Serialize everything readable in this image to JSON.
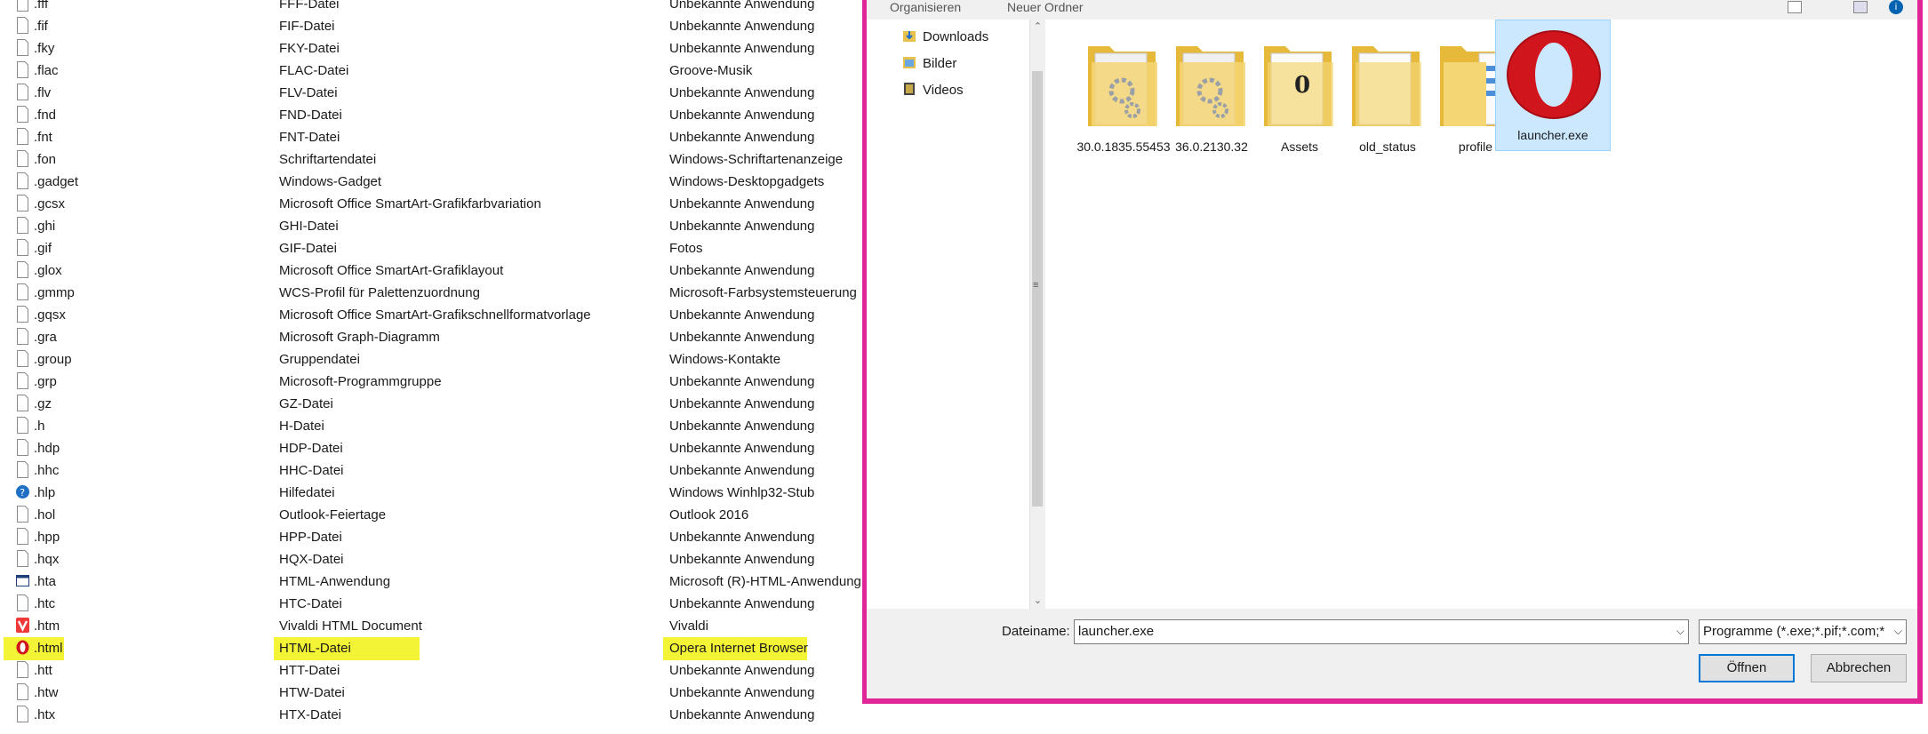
{
  "list": {
    "rows": [
      {
        "ext": ".fff",
        "desc": "FFF-Datei",
        "app": "Unbekannte Anwendung"
      },
      {
        "ext": ".fif",
        "desc": "FIF-Datei",
        "app": "Unbekannte Anwendung"
      },
      {
        "ext": ".fky",
        "desc": "FKY-Datei",
        "app": "Unbekannte Anwendung"
      },
      {
        "ext": ".flac",
        "desc": "FLAC-Datei",
        "app": "Groove-Musik"
      },
      {
        "ext": ".flv",
        "desc": "FLV-Datei",
        "app": "Unbekannte Anwendung"
      },
      {
        "ext": ".fnd",
        "desc": "FND-Datei",
        "app": "Unbekannte Anwendung"
      },
      {
        "ext": ".fnt",
        "desc": "FNT-Datei",
        "app": "Unbekannte Anwendung"
      },
      {
        "ext": ".fon",
        "desc": "Schriftartendatei",
        "app": "Windows-Schriftartenanzeige"
      },
      {
        "ext": ".gadget",
        "desc": "Windows-Gadget",
        "app": "Windows-Desktopgadgets"
      },
      {
        "ext": ".gcsx",
        "desc": "Microsoft Office SmartArt-Grafikfarbvariation",
        "app": "Unbekannte Anwendung"
      },
      {
        "ext": ".ghi",
        "desc": "GHI-Datei",
        "app": "Unbekannte Anwendung"
      },
      {
        "ext": ".gif",
        "desc": "GIF-Datei",
        "app": "Fotos"
      },
      {
        "ext": ".glox",
        "desc": "Microsoft Office SmartArt-Grafiklayout",
        "app": "Unbekannte Anwendung"
      },
      {
        "ext": ".gmmp",
        "desc": "WCS-Profil für Palettenzuordnung",
        "app": "Microsoft-Farbsystemsteuerung"
      },
      {
        "ext": ".gqsx",
        "desc": "Microsoft Office SmartArt-Grafikschnellformatvorlage",
        "app": "Unbekannte Anwendung"
      },
      {
        "ext": ".gra",
        "desc": "Microsoft Graph-Diagramm",
        "app": "Unbekannte Anwendung"
      },
      {
        "ext": ".group",
        "desc": "Gruppendatei",
        "app": "Windows-Kontakte"
      },
      {
        "ext": ".grp",
        "desc": "Microsoft-Programmgruppe",
        "app": "Unbekannte Anwendung"
      },
      {
        "ext": ".gz",
        "desc": "GZ-Datei",
        "app": "Unbekannte Anwendung"
      },
      {
        "ext": ".h",
        "desc": "H-Datei",
        "app": "Unbekannte Anwendung"
      },
      {
        "ext": ".hdp",
        "desc": "HDP-Datei",
        "app": "Unbekannte Anwendung"
      },
      {
        "ext": ".hhc",
        "desc": "HHC-Datei",
        "app": "Unbekannte Anwendung"
      },
      {
        "ext": ".hlp",
        "desc": "Hilfedatei",
        "app": "Windows Winhlp32-Stub"
      },
      {
        "ext": ".hol",
        "desc": "Outlook-Feiertage",
        "app": "Outlook 2016"
      },
      {
        "ext": ".hpp",
        "desc": "HPP-Datei",
        "app": "Unbekannte Anwendung"
      },
      {
        "ext": ".hqx",
        "desc": "HQX-Datei",
        "app": "Unbekannte Anwendung"
      },
      {
        "ext": ".hta",
        "desc": "HTML-Anwendung",
        "app": "Microsoft (R)-HTML-Anwendung"
      },
      {
        "ext": ".htc",
        "desc": "HTC-Datei",
        "app": "Unbekannte Anwendung"
      },
      {
        "ext": ".htm",
        "desc": "Vivaldi HTML Document",
        "app": "Vivaldi"
      },
      {
        "ext": ".html",
        "desc": "HTML-Datei",
        "app": "Opera Internet Browser"
      },
      {
        "ext": ".htt",
        "desc": "HTT-Datei",
        "app": "Unbekannte Anwendung"
      },
      {
        "ext": ".htw",
        "desc": "HTW-Datei",
        "app": "Unbekannte Anwendung"
      },
      {
        "ext": ".htx",
        "desc": "HTX-Datei",
        "app": "Unbekannte Anwendung"
      }
    ]
  },
  "dialog": {
    "toolbar": {
      "organize": "Organisieren",
      "new_folder": "Neuer Ordner"
    },
    "nav": [
      {
        "label": "Downloads",
        "icon": "downloads-icon"
      },
      {
        "label": "Bilder",
        "icon": "pictures-icon"
      },
      {
        "label": "Videos",
        "icon": "videos-icon"
      }
    ],
    "files": [
      {
        "name": "30.0.1835.55453",
        "type": "gear-folder"
      },
      {
        "name": "36.0.2130.32",
        "type": "gear-folder"
      },
      {
        "name": "Assets",
        "type": "zero-folder"
      },
      {
        "name": "old_status",
        "type": "empty-folder"
      },
      {
        "name": "profile",
        "type": "doc-folder"
      },
      {
        "name": "launcher.exe",
        "type": "opera-exe"
      }
    ],
    "filename_label": "Dateiname:",
    "filename_value": "launcher.exe",
    "filter_value": "Programme (*.exe;*.pif;*.com;*.bat",
    "open_button": "Öffnen",
    "cancel_button": "Abbrechen"
  },
  "colors": {
    "highlight": "#f4f436",
    "dialog_border": "#e02596",
    "opera_red": "#d1151d",
    "selection": "#cce8ff"
  }
}
